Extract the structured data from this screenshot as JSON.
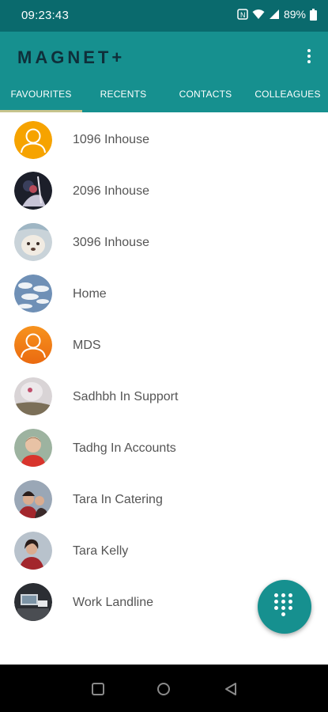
{
  "status": {
    "time": "09:23:43",
    "battery": "89%"
  },
  "app": {
    "logo": "MAGNET+"
  },
  "tabs": [
    {
      "label": "FAVOURITES",
      "active": true
    },
    {
      "label": "RECENTS",
      "active": false
    },
    {
      "label": "CONTACTS",
      "active": false
    },
    {
      "label": "COLLEAGUES",
      "active": false
    }
  ],
  "contacts": [
    {
      "name": "1096 Inhouse",
      "avatar": "default-orange-avatar"
    },
    {
      "name": "2096 Inhouse",
      "avatar": "photo"
    },
    {
      "name": "3096 Inhouse",
      "avatar": "dog-photo"
    },
    {
      "name": "Home",
      "avatar": "sky-photo"
    },
    {
      "name": "MDS",
      "avatar": "default-orange-avatar"
    },
    {
      "name": "Sadhbh In Support",
      "avatar": "photo"
    },
    {
      "name": "Tadhg In Accounts",
      "avatar": "child-photo"
    },
    {
      "name": "Tara In Catering",
      "avatar": "photo"
    },
    {
      "name": "Tara Kelly",
      "avatar": "photo"
    },
    {
      "name": "Work Landline",
      "avatar": "desk-photo"
    }
  ],
  "colors": {
    "primary": "#16908f",
    "statusbar": "#0a6a6d",
    "indicator": "#c7c48d",
    "avatar_orange": "#f6a300"
  }
}
